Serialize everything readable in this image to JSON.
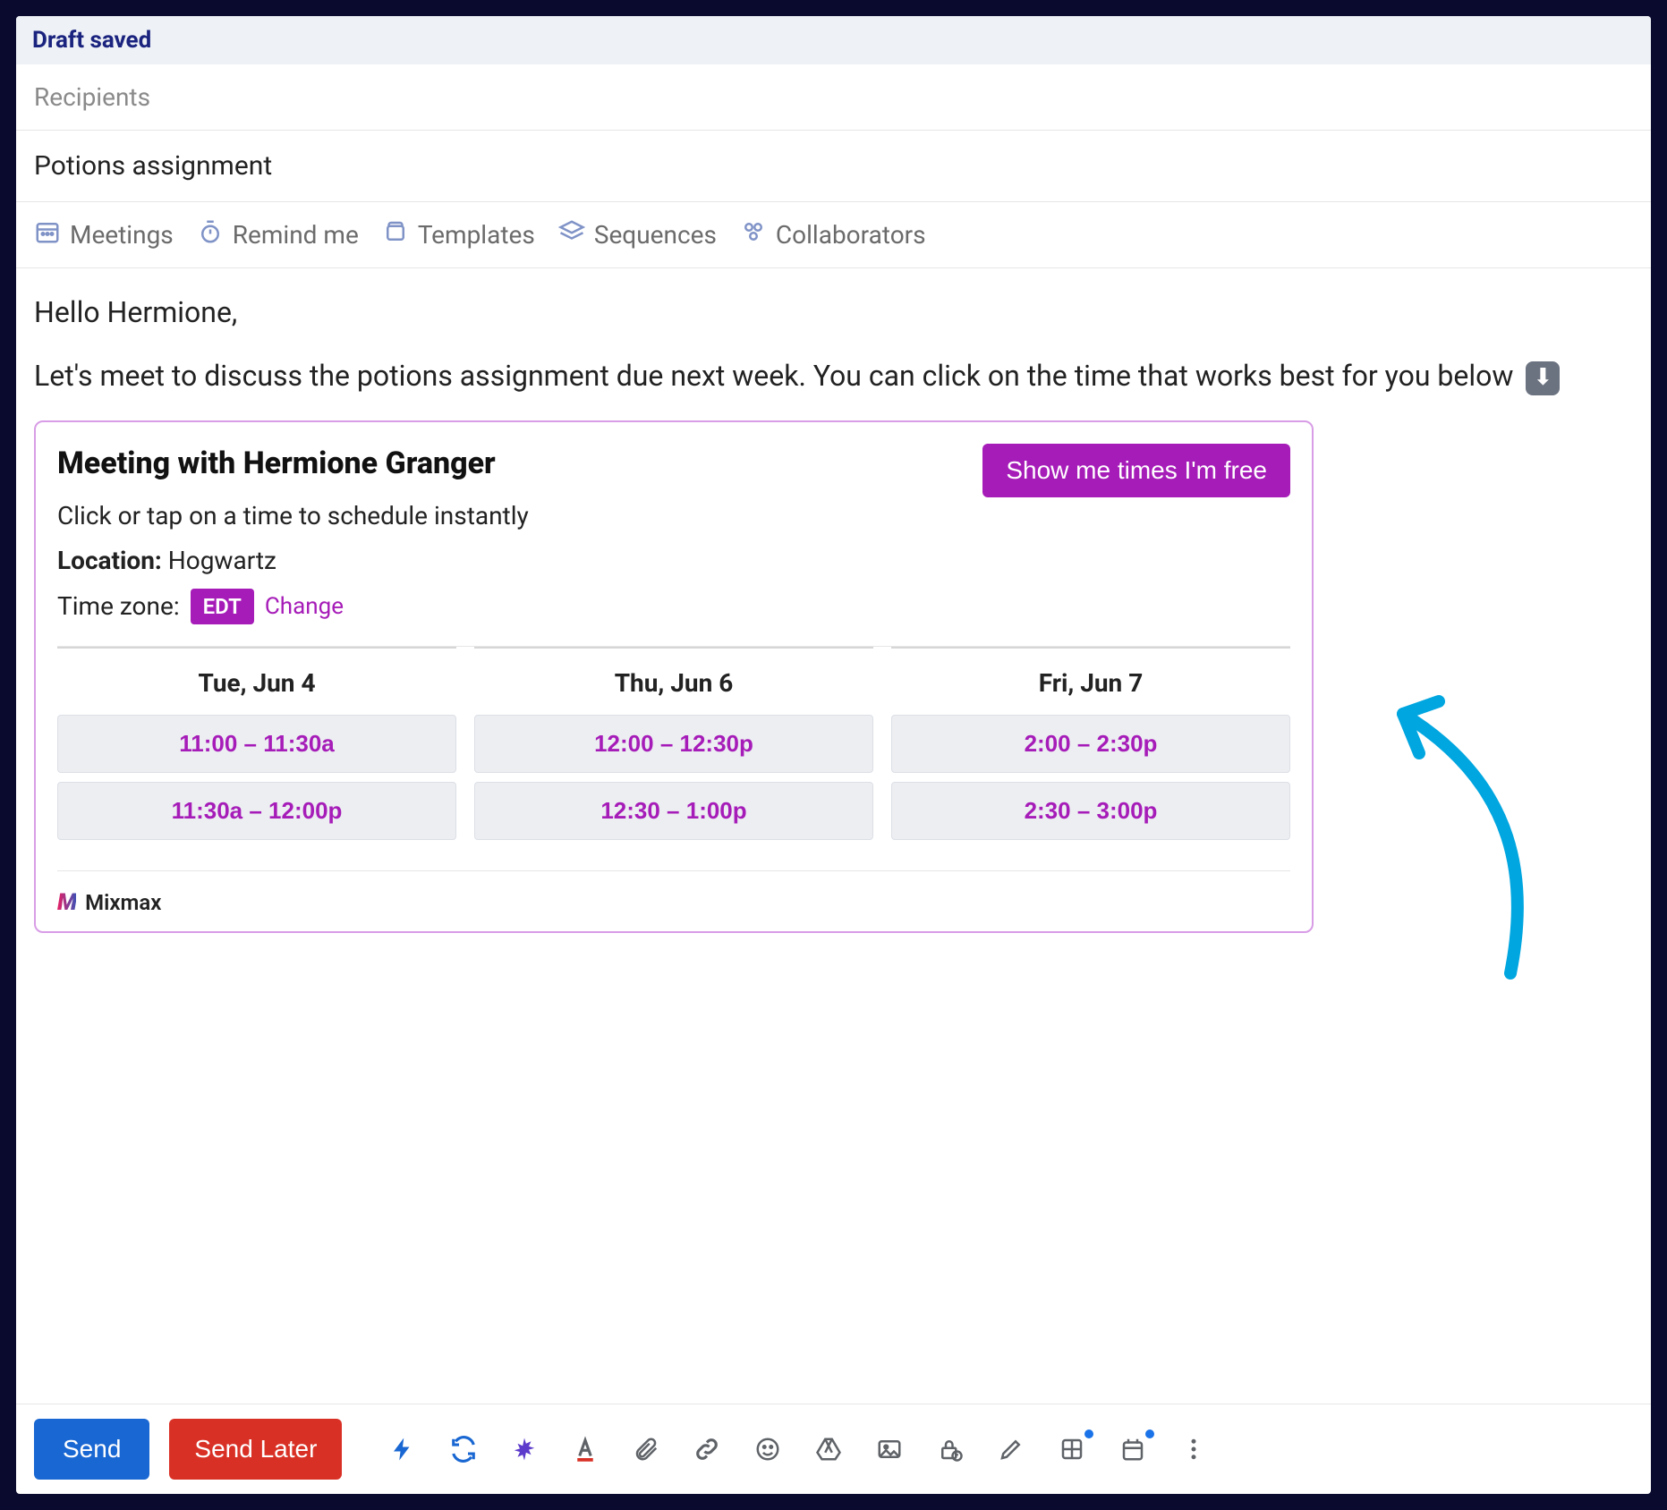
{
  "status": {
    "text": "Draft saved"
  },
  "recipients": {
    "placeholder": "Recipients"
  },
  "subject": {
    "value": "Potions assignment"
  },
  "toolbar": {
    "meetings": "Meetings",
    "remind": "Remind me",
    "templates": "Templates",
    "sequences": "Sequences",
    "collaborators": "Collaborators"
  },
  "body": {
    "greeting": "Hello Hermione,",
    "para1": "Let's meet to discuss the potions assignment due next week. You can click on the time that works best for you below"
  },
  "meeting": {
    "title": "Meeting with Hermione Granger",
    "cta": "Show me times I'm free",
    "subtitle": "Click or tap on a time to schedule instantly",
    "location_label": "Location:",
    "location_value": "Hogwartz",
    "tz_label": "Time zone:",
    "tz_badge": "EDT",
    "tz_change": "Change",
    "brand": "Mixmax",
    "columns": [
      {
        "header": "Tue, Jun 4",
        "slots": [
          "11:00 – 11:30a",
          "11:30a – 12:00p"
        ]
      },
      {
        "header": "Thu, Jun 6",
        "slots": [
          "12:00 – 12:30p",
          "12:30 – 1:00p"
        ]
      },
      {
        "header": "Fri, Jun 7",
        "slots": [
          "2:00 – 2:30p",
          "2:30 – 3:00p"
        ]
      }
    ]
  },
  "footer": {
    "send": "Send",
    "send_later": "Send Later"
  }
}
